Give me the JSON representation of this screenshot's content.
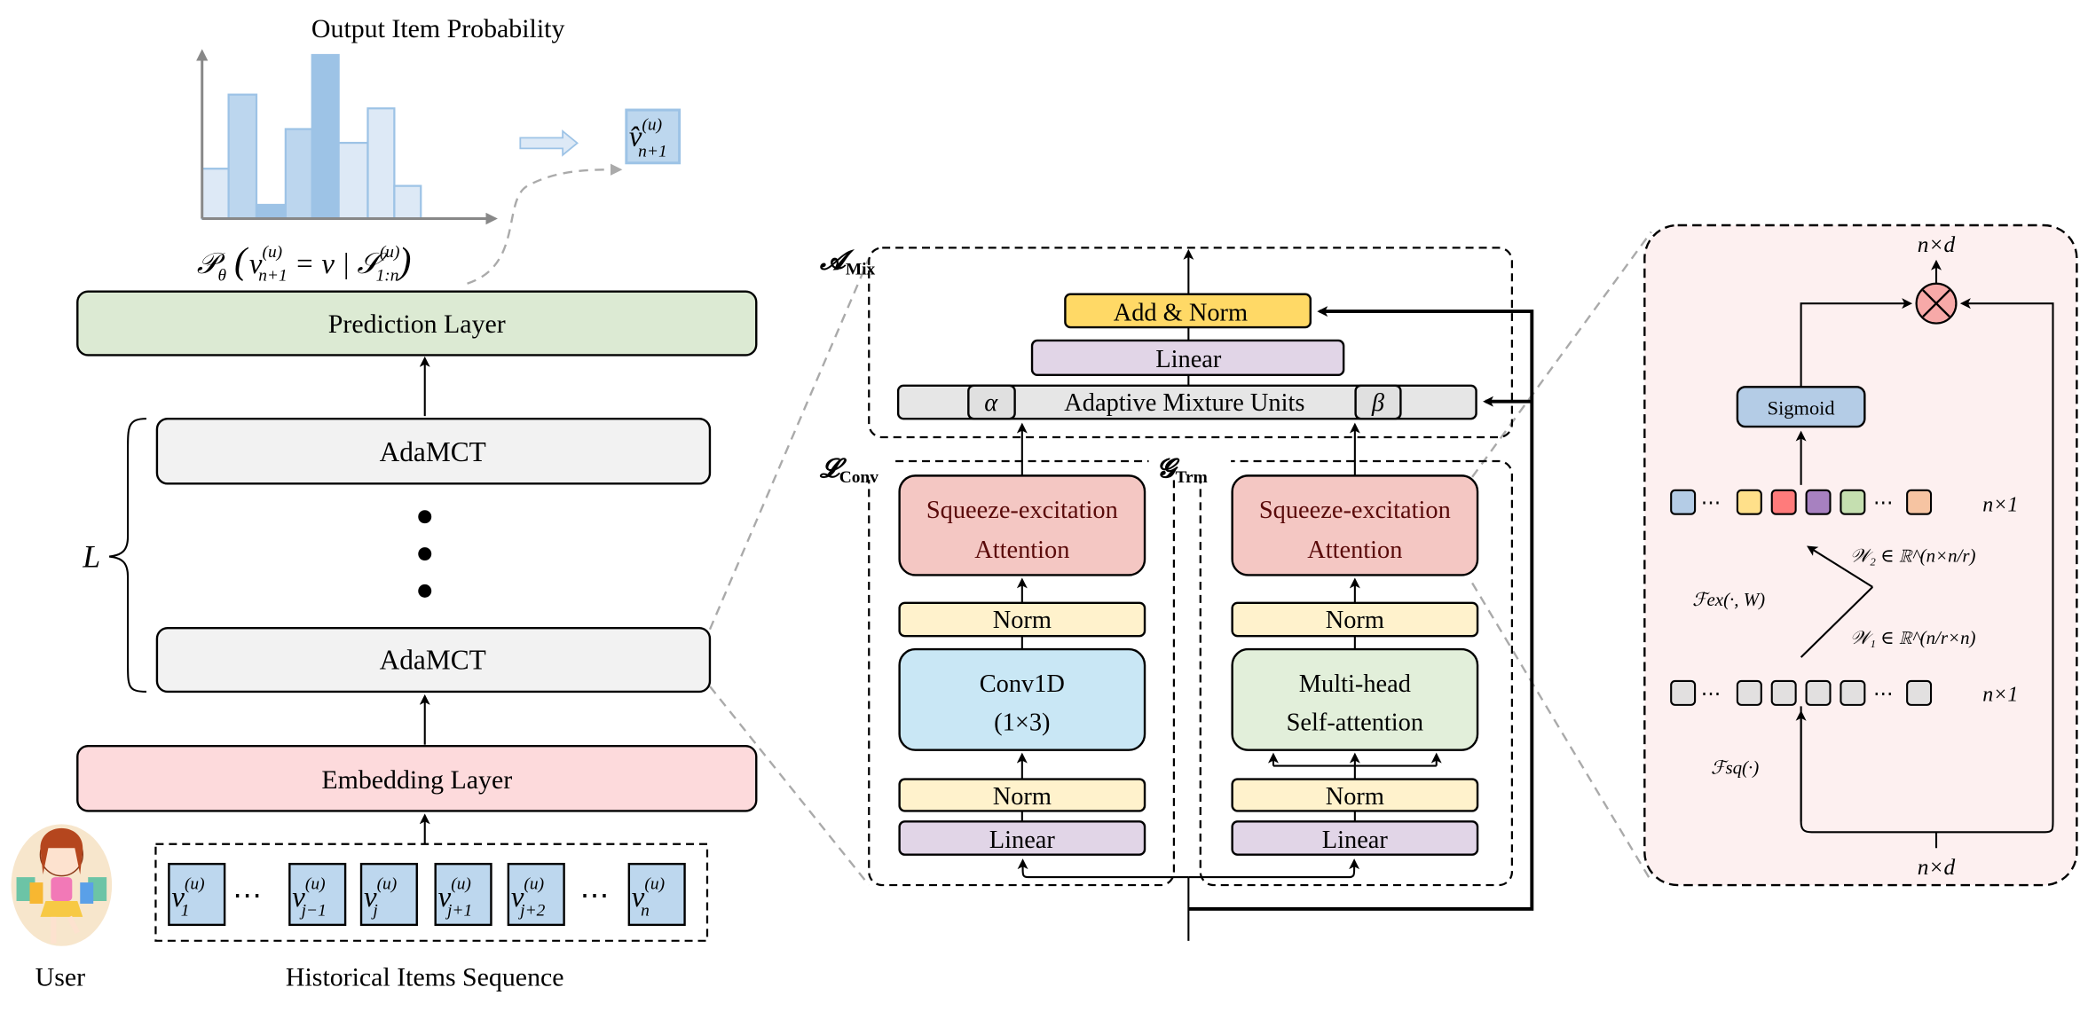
{
  "histogram": {
    "title": "Output Item Probability",
    "bar_levels": [
      0.29,
      0.72,
      0.08,
      0.52,
      0.95,
      0.44,
      0.64,
      0.19
    ],
    "bar_colors": [
      "#dde9f6",
      "#bcd6ee",
      "#9dc3e6",
      "#bcd6ee",
      "#9dc3e6",
      "#dde9f6",
      "#dde9f6",
      "#dde9f6"
    ]
  },
  "output_item": {
    "base": "v̂",
    "sup": "(u)",
    "sub": "n+1"
  },
  "formula": {
    "p": "𝒫",
    "theta": "θ",
    "open": "(",
    "v": "v",
    "sup": "(u)",
    "sub": "n+1",
    "mid": " = v | ",
    "s": "𝒮",
    "s_sup": "(u)",
    "s_sub": "1:n",
    "close": ")"
  },
  "left": {
    "prediction_layer": "Prediction Layer",
    "adamct_top": "AdaMCT",
    "adamct_bottom": "AdaMCT",
    "layers_label": "L",
    "embedding_layer": "Embedding Layer",
    "user_label": "User",
    "sequence_label": "Historical Items Sequence",
    "sequence_items": [
      {
        "base": "v",
        "sup": "(u)",
        "sub": "1"
      },
      {
        "base": "v",
        "sup": "(u)",
        "sub": "j−1"
      },
      {
        "base": "v",
        "sup": "(u)",
        "sub": "j"
      },
      {
        "base": "v",
        "sup": "(u)",
        "sub": "j+1"
      },
      {
        "base": "v",
        "sup": "(u)",
        "sub": "j+2"
      },
      {
        "base": "v",
        "sup": "(u)",
        "sub": "n"
      }
    ],
    "ellipsis": "⋯"
  },
  "middle": {
    "mix_label": {
      "main": "𝓐",
      "sub": "Mix"
    },
    "conv_label": {
      "main": "𝓛",
      "sub": "Conv"
    },
    "trm_label": {
      "main": "𝓖",
      "sub": "Trm"
    },
    "add_norm": "Add & Norm",
    "linear_top": "Linear",
    "amu": "Adaptive Mixture Units",
    "alpha": "α",
    "beta": "β",
    "conv_column": {
      "se_1": "Squeeze-excitation",
      "se_2": "Attention",
      "norm_top": "Norm",
      "op_1": "Conv1D",
      "op_2": "(1×3)",
      "norm_bottom": "Norm",
      "linear": "Linear"
    },
    "trm_column": {
      "se_1": "Squeeze-excitation",
      "se_2": "Attention",
      "norm_top": "Norm",
      "op_1": "Multi-head",
      "op_2": "Self-attention",
      "norm_bottom": "Norm",
      "linear": "Linear"
    }
  },
  "se_detail": {
    "out_dim": "n×d",
    "in_dim": "n×d",
    "sigmoid": "Sigmoid",
    "row_dim_top": "n×1",
    "row_dim_bottom": "n×1",
    "excite_colors": [
      "#b4cce6",
      "#ffe08a",
      "#ff7b7b",
      "#a781c0",
      "#c5dfb0",
      "#f6c4a2"
    ],
    "squeeze_color": "#e2e0e0",
    "w2": "𝒲₂ ∈ ℝ^(n×n/r)",
    "w1": "𝒲₁ ∈ ℝ^(n/r×n)",
    "fex": "ℱex(·, W)",
    "fsq": "ℱsq(·)",
    "dots": "⋯"
  },
  "colors": {
    "prediction": "#dcead3",
    "adamct": "#f2f2f2",
    "embedding": "#fddadc",
    "item": "#bdd7ee",
    "add_norm": "#ffd966",
    "linear": "#e1d5e7",
    "amu": "#e6e6e6",
    "se": "#f4c7c3",
    "norm": "#fff2cc",
    "conv": "#c9e7f5",
    "mha": "#e2efda",
    "panel": "#fdf0f0"
  }
}
